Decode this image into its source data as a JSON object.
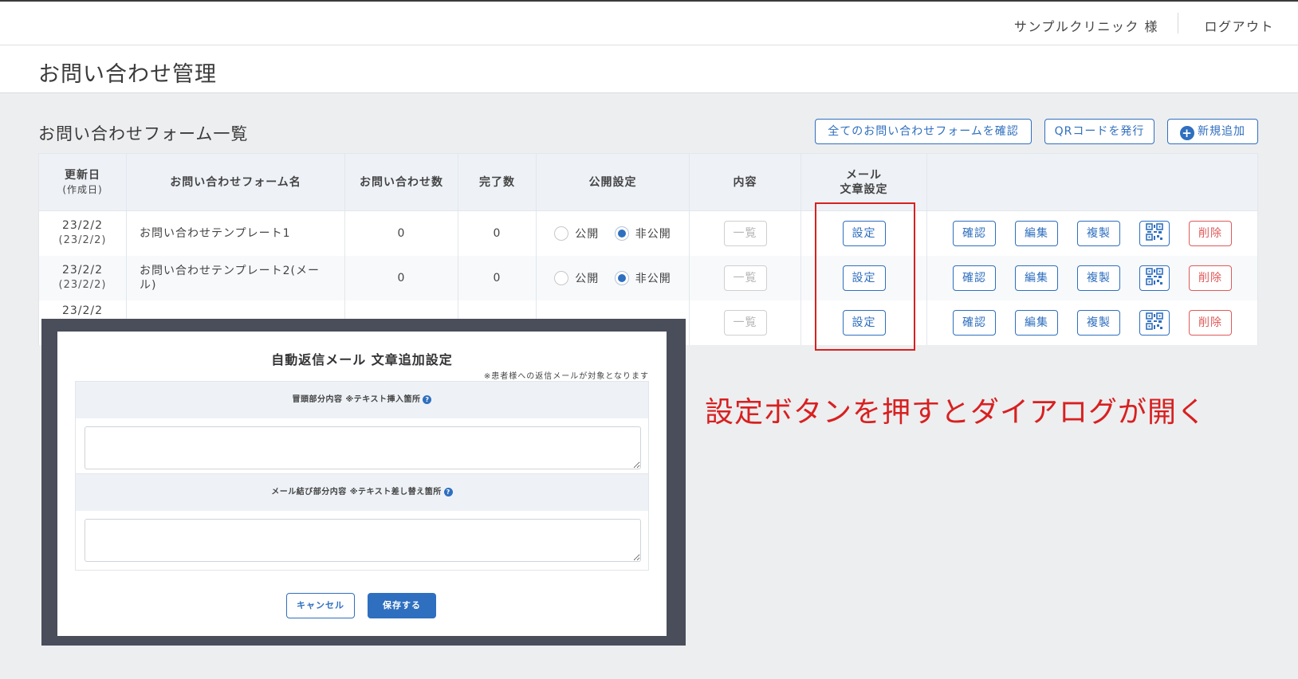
{
  "header": {
    "user_name": "サンプルクリニック 様",
    "logout_label": "ログアウト"
  },
  "page": {
    "title": "お問い合わせ管理"
  },
  "section": {
    "title": "お問い合わせフォーム一覧",
    "buttons": {
      "view_all": "全てのお問い合わせフォームを確認",
      "qr_issue": "QRコードを発行",
      "add_new": "新規追加"
    }
  },
  "table": {
    "headers": {
      "updated_line1": "更新日",
      "updated_line2": "(作成日)",
      "form_name": "お問い合わせフォーム名",
      "inquiry_count": "お問い合わせ数",
      "complete_count": "完了数",
      "publish": "公開設定",
      "content": "内容",
      "mail_line1": "メール",
      "mail_line2": "文章設定"
    },
    "radio_labels": {
      "public": "公開",
      "private": "非公開"
    },
    "button_labels": {
      "list": "一覧",
      "setting": "設定",
      "confirm": "確認",
      "edit": "編集",
      "duplicate": "複製",
      "delete": "削除"
    },
    "rows": [
      {
        "updated": "23/2/2",
        "created": "(23/2/2)",
        "name": "お問い合わせテンプレート1",
        "inquiries": "0",
        "completed": "0",
        "published": false
      },
      {
        "updated": "23/2/2",
        "created": "(23/2/2)",
        "name": "お問い合わせテンプレート2(メール)",
        "inquiries": "0",
        "completed": "0",
        "published": false
      },
      {
        "updated": "23/2/2",
        "created": "",
        "name": "",
        "inquiries": "",
        "completed": "",
        "published": false
      }
    ]
  },
  "annotation": {
    "text": "設定ボタンを押すとダイアログが開く",
    "color": "#d82020"
  },
  "dialog": {
    "title": "自動返信メール 文章追加設定",
    "note": "※患者様への返信メールが対象となります",
    "header_section": {
      "label": "冒頭部分内容 ※テキスト挿入箇所",
      "value": ""
    },
    "footer_section": {
      "label": "メール結び部分内容 ※テキスト差し替え箇所",
      "value": ""
    },
    "cancel_label": "キャンセル",
    "save_label": "保存する"
  },
  "colors": {
    "accent": "#2f6fbf",
    "danger": "#e05a5a",
    "highlight": "#d82020"
  }
}
